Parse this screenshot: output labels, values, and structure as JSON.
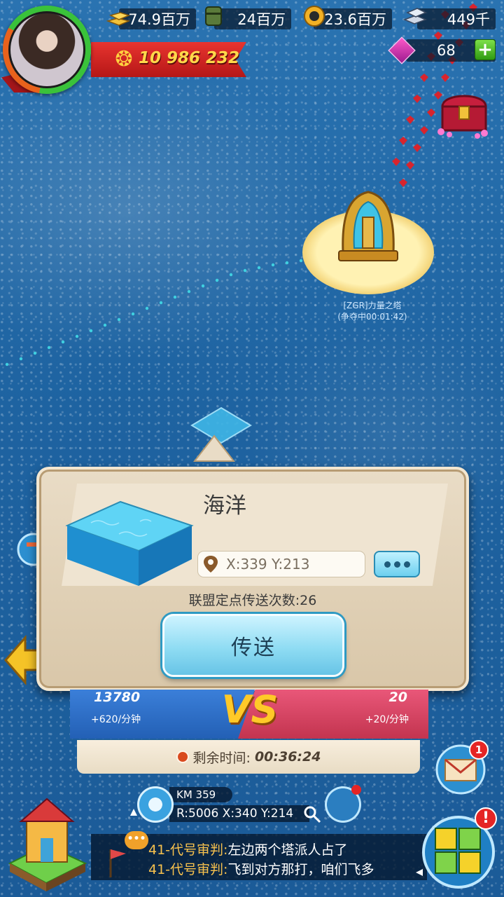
{
  "player": {
    "power": "10 986 232"
  },
  "resources": [
    {
      "name": "gold",
      "icon": "gold-bars-icon",
      "value": "74.9百万"
    },
    {
      "name": "food",
      "icon": "barrel-icon",
      "value": "24百万"
    },
    {
      "name": "oil",
      "icon": "oil-coin-icon",
      "value": "23.6百万"
    },
    {
      "name": "steel",
      "icon": "steel-ingot-icon",
      "value": "449千"
    }
  ],
  "gems": {
    "value": "68",
    "add_label": "+"
  },
  "map": {
    "tower": {
      "name": "[ZGR]力量之塔",
      "status": "(争夺中00:01:42)"
    }
  },
  "popup": {
    "title": "海洋",
    "coords": "X:339 Y:213",
    "teleport_count": "联盟定点传送次数:26",
    "teleport_button": "传送"
  },
  "vs": {
    "left_score": "13780",
    "left_rate": "+620/分钟",
    "right_score": "20",
    "right_rate": "+20/分钟",
    "logo": "VS",
    "time_label": "剩余时间:",
    "time_value": "00:36:24"
  },
  "mail": {
    "badge": "1"
  },
  "location": {
    "km": "KM 359",
    "coords": "R:5006 X:340 Y:214"
  },
  "chat": {
    "lines": [
      {
        "who": "41-代号审判",
        "text": "左边两个塔派人占了"
      },
      {
        "who": "41-代号审判",
        "text": "飞到对方那打，咱们飞多"
      }
    ]
  },
  "build_menu": {
    "badge": "!"
  },
  "colors": {
    "ocean": "#1f6aa8",
    "team_blue": "#2360b5",
    "team_red": "#c3344f",
    "accent_gold": "#ffc928",
    "teleport_button": "#8fdcf3"
  }
}
